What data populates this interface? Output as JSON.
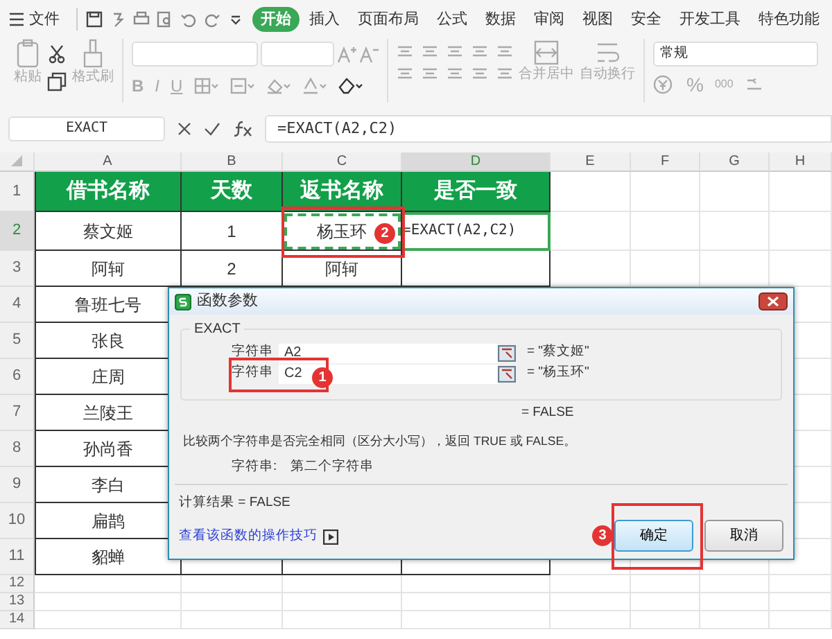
{
  "menu": {
    "file": "文件",
    "tabs": [
      {
        "label": "开始",
        "selected": true
      },
      {
        "label": "插入",
        "selected": false
      },
      {
        "label": "页面布局",
        "selected": false
      },
      {
        "label": "公式",
        "selected": false
      },
      {
        "label": "数据",
        "selected": false
      },
      {
        "label": "审阅",
        "selected": false
      },
      {
        "label": "视图",
        "selected": false
      },
      {
        "label": "安全",
        "selected": false
      },
      {
        "label": "开发工具",
        "selected": false
      },
      {
        "label": "特色功能",
        "selected": false
      }
    ]
  },
  "toolbar": {
    "paste": "粘贴",
    "format_painter": "格式刷",
    "text_styles": [
      "B",
      "I",
      "U"
    ],
    "merge": "合并居中",
    "wrap": "自动换行",
    "number_format": "常规",
    "percent": "%",
    "thousands": "000"
  },
  "formula_bar": {
    "name_box": "EXACT",
    "formula": "=EXACT(A2,C2)"
  },
  "sheet": {
    "columns": [
      {
        "label": "A",
        "selected": false,
        "referenced": false
      },
      {
        "label": "B",
        "selected": false,
        "referenced": false
      },
      {
        "label": "C",
        "selected": false,
        "referenced": true
      },
      {
        "label": "D",
        "selected": true,
        "referenced": false
      },
      {
        "label": "E",
        "selected": false,
        "referenced": false
      },
      {
        "label": "F",
        "selected": false,
        "referenced": false
      },
      {
        "label": "G",
        "selected": false,
        "referenced": false
      },
      {
        "label": "H",
        "selected": false,
        "referenced": false
      }
    ],
    "rows": [
      {
        "number": "1",
        "selected": false,
        "kind": "header",
        "cells": [
          "借书名称",
          "天数",
          "返书名称",
          "是否一致"
        ]
      },
      {
        "number": "2",
        "selected": true,
        "kind": "data",
        "cells": [
          "蔡文姬",
          "1",
          "杨玉环",
          "=EXACT(A2,C2)"
        ]
      },
      {
        "number": "3",
        "selected": false,
        "kind": "data",
        "cells": [
          "阿轲",
          "2",
          "阿轲",
          ""
        ]
      },
      {
        "number": "4",
        "selected": false,
        "kind": "data",
        "cells": [
          "鲁班七号"
        ]
      },
      {
        "number": "5",
        "selected": false,
        "kind": "data",
        "cells": [
          "张良"
        ]
      },
      {
        "number": "6",
        "selected": false,
        "kind": "data",
        "cells": [
          "庄周"
        ]
      },
      {
        "number": "7",
        "selected": false,
        "kind": "data",
        "cells": [
          "兰陵王"
        ]
      },
      {
        "number": "8",
        "selected": false,
        "kind": "data",
        "cells": [
          "孙尚香"
        ]
      },
      {
        "number": "9",
        "selected": false,
        "kind": "data",
        "cells": [
          "李白"
        ]
      },
      {
        "number": "10",
        "selected": false,
        "kind": "data",
        "cells": [
          "扁鹊"
        ]
      },
      {
        "number": "11",
        "selected": false,
        "kind": "data",
        "cells": [
          "貂蝉"
        ]
      },
      {
        "number": "12",
        "selected": false,
        "kind": "empty",
        "cells": []
      },
      {
        "number": "13",
        "selected": false,
        "kind": "empty",
        "cells": []
      },
      {
        "number": "14",
        "selected": false,
        "kind": "empty",
        "cells": []
      }
    ]
  },
  "dialog": {
    "title": "函数参数",
    "function": "EXACT",
    "args": [
      {
        "label": "字符串",
        "value": "A2",
        "result": "= \"蔡文姬\""
      },
      {
        "label": "字符串",
        "value": "C2",
        "result": "= \"杨玉环\""
      }
    ],
    "result": "= FALSE",
    "description": "比较两个字符串是否完全相同（区分大小写），返回 TRUE 或 FALSE。",
    "arg_help_label": "字符串:",
    "arg_help": "第二个字符串",
    "calc_result": "计算结果 = FALSE",
    "help_link": "查看该函数的操作技巧",
    "buttons": [
      {
        "label": "确定",
        "default": true
      },
      {
        "label": "取消",
        "default": false
      }
    ]
  },
  "annotations": [
    {
      "number": "1",
      "kind": "argument"
    },
    {
      "number": "2",
      "kind": "cell"
    },
    {
      "number": "3",
      "kind": "button"
    }
  ]
}
